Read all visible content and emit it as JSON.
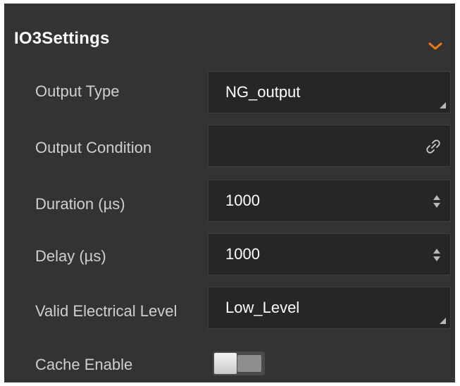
{
  "panel": {
    "title": "IO3Settings",
    "accent_color": "#f07814",
    "toggle_icon": "chevron-down-icon"
  },
  "fields": {
    "output_type": {
      "label": "Output Type",
      "value": "NG_output"
    },
    "output_condition": {
      "label": "Output Condition",
      "value": "",
      "icon": "link-icon"
    },
    "duration": {
      "label": "Duration (µs)",
      "value": "1000"
    },
    "delay": {
      "label": "Delay (µs)",
      "value": "1000"
    },
    "valid_level": {
      "label": "Valid Electrical Level",
      "value": "Low_Level"
    },
    "cache_enable": {
      "label": "Cache Enable",
      "state": "off"
    }
  }
}
